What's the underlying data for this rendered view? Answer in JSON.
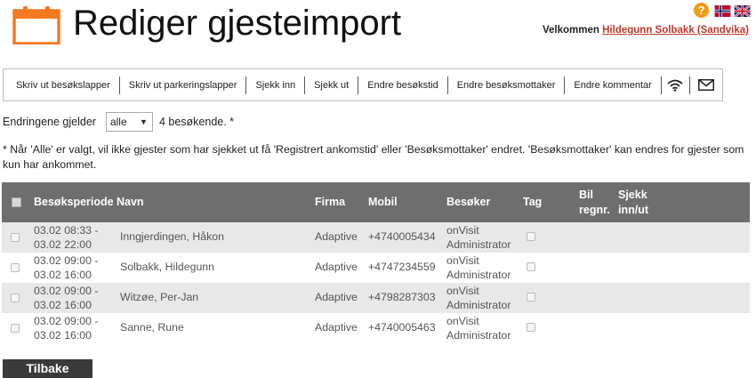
{
  "header": {
    "title": "Rediger gjesteimport",
    "welcome_label": "Velkommen",
    "welcome_user": "Hildegunn Solbakk (Sandvika)",
    "help_glyph": "?",
    "icons": [
      "calendar-icon",
      "help-icon",
      "flag-norway-icon",
      "flag-uk-icon"
    ]
  },
  "toolbar": {
    "buttons": [
      "Skriv ut besøkslapper",
      "Skriv ut parkeringslapper",
      "Sjekk inn",
      "Sjekk ut",
      "Endre besøkstid",
      "Endre besøksmottaker",
      "Endre kommentar"
    ],
    "icons": [
      "wifi-icon",
      "envelope-icon"
    ]
  },
  "filter": {
    "label": "Endringene gjelder",
    "selected": "alle",
    "count_text": "4 besøkende. *"
  },
  "note": "* Når 'Alle' er valgt, vil ikke gjester som har sjekket ut få 'Registrert ankomstid' eller 'Besøksmottaker' endret. 'Besøksmottaker' kan endres for gjester som kun har ankommet.",
  "table": {
    "columns": {
      "period": "Besøksperiode",
      "name": "Navn",
      "company": "Firma",
      "mobile": "Mobil",
      "visitor": "Besøker",
      "tag": "Tag",
      "car_1": "Bil",
      "car_2": "regnr.",
      "check_1": "Sjekk",
      "check_2": "inn/ut"
    },
    "rows": [
      {
        "period_start": "03.02 08:33 -",
        "period_end": "03.02 22:00",
        "name": "Inngjerdingen, Håkon",
        "company": "Adaptive",
        "mobile": "+4740005434",
        "visitor_1": "onVisit",
        "visitor_2": "Administrator"
      },
      {
        "period_start": "03.02 09:00 -",
        "period_end": "03.02 16:00",
        "name": "Solbakk, Hildegunn",
        "company": "Adaptive",
        "mobile": "+4747234559",
        "visitor_1": "onVisit",
        "visitor_2": "Administrator"
      },
      {
        "period_start": "03.02 09:00 -",
        "period_end": "03.02 16:00",
        "name": "Witzøe, Per-Jan",
        "company": "Adaptive",
        "mobile": "+4798287303",
        "visitor_1": "onVisit",
        "visitor_2": "Administrator"
      },
      {
        "period_start": "03.02 09:00 -",
        "period_end": "03.02 16:00",
        "name": "Sanne, Rune",
        "company": "Adaptive",
        "mobile": "+4740005463",
        "visitor_1": "onVisit",
        "visitor_2": "Administrator"
      }
    ]
  },
  "footer": {
    "back_label": "Tilbake"
  },
  "colors": {
    "accent": "#f47a20",
    "table_header": "#6e6e6e",
    "row_alt": "#e8e8e8",
    "user_link": "#c0392b",
    "back_button": "#3a3a3a"
  }
}
